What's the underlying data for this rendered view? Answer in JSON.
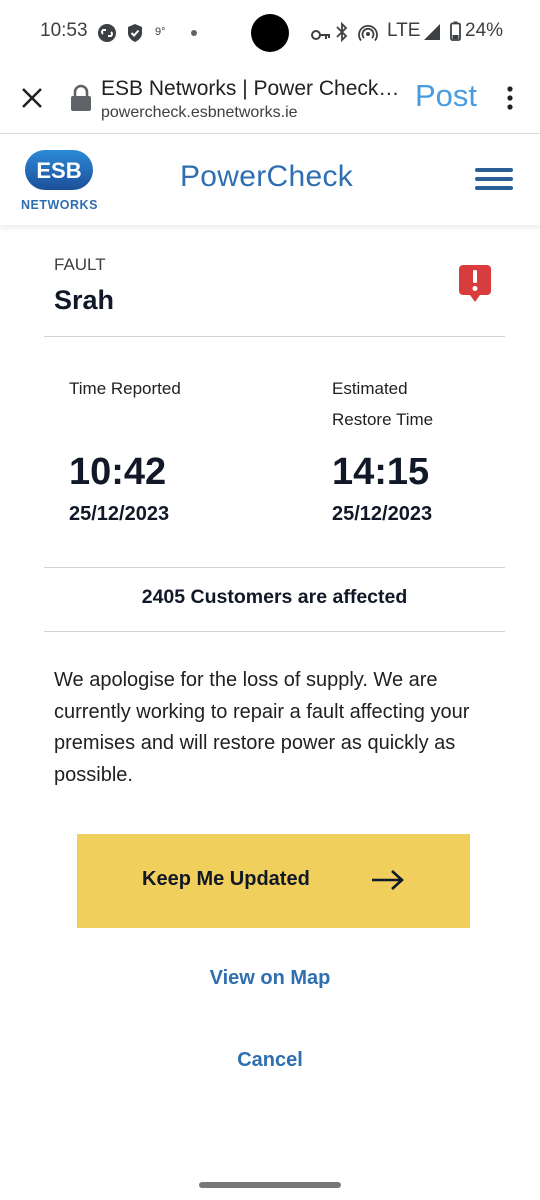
{
  "status_bar": {
    "time": "10:53",
    "weather": "9°",
    "network": "LTE",
    "battery": "24%"
  },
  "browser": {
    "page_title": "ESB Networks | Power Check |...",
    "url": "powercheck.esbnetworks.ie",
    "post_action": "Post"
  },
  "site": {
    "logo_text": "ESB",
    "logo_sub": "NETWORKS",
    "brand": "PowerCheck"
  },
  "fault": {
    "type_label": "FAULT",
    "location": "Srah"
  },
  "times": {
    "reported_label": "Time Reported",
    "reported_time": "10:42",
    "reported_date": "25/12/2023",
    "restore_label_line1": "Estimated",
    "restore_label_line2": "Restore Time",
    "restore_time": "14:15",
    "restore_date": "25/12/2023"
  },
  "affected_text": "2405 Customers are affected",
  "message": "We apologise for the loss of supply. We are currently working to repair a fault affecting your premises and will restore power as quickly as possible.",
  "actions": {
    "keep_updated": "Keep Me Updated",
    "view_map": "View on Map",
    "cancel": "Cancel"
  },
  "colors": {
    "brand_blue": "#2f6fb0",
    "button_yellow": "#f1cf5c",
    "alert_red": "#d93c3c",
    "link_blue": "#4a9ce0"
  }
}
